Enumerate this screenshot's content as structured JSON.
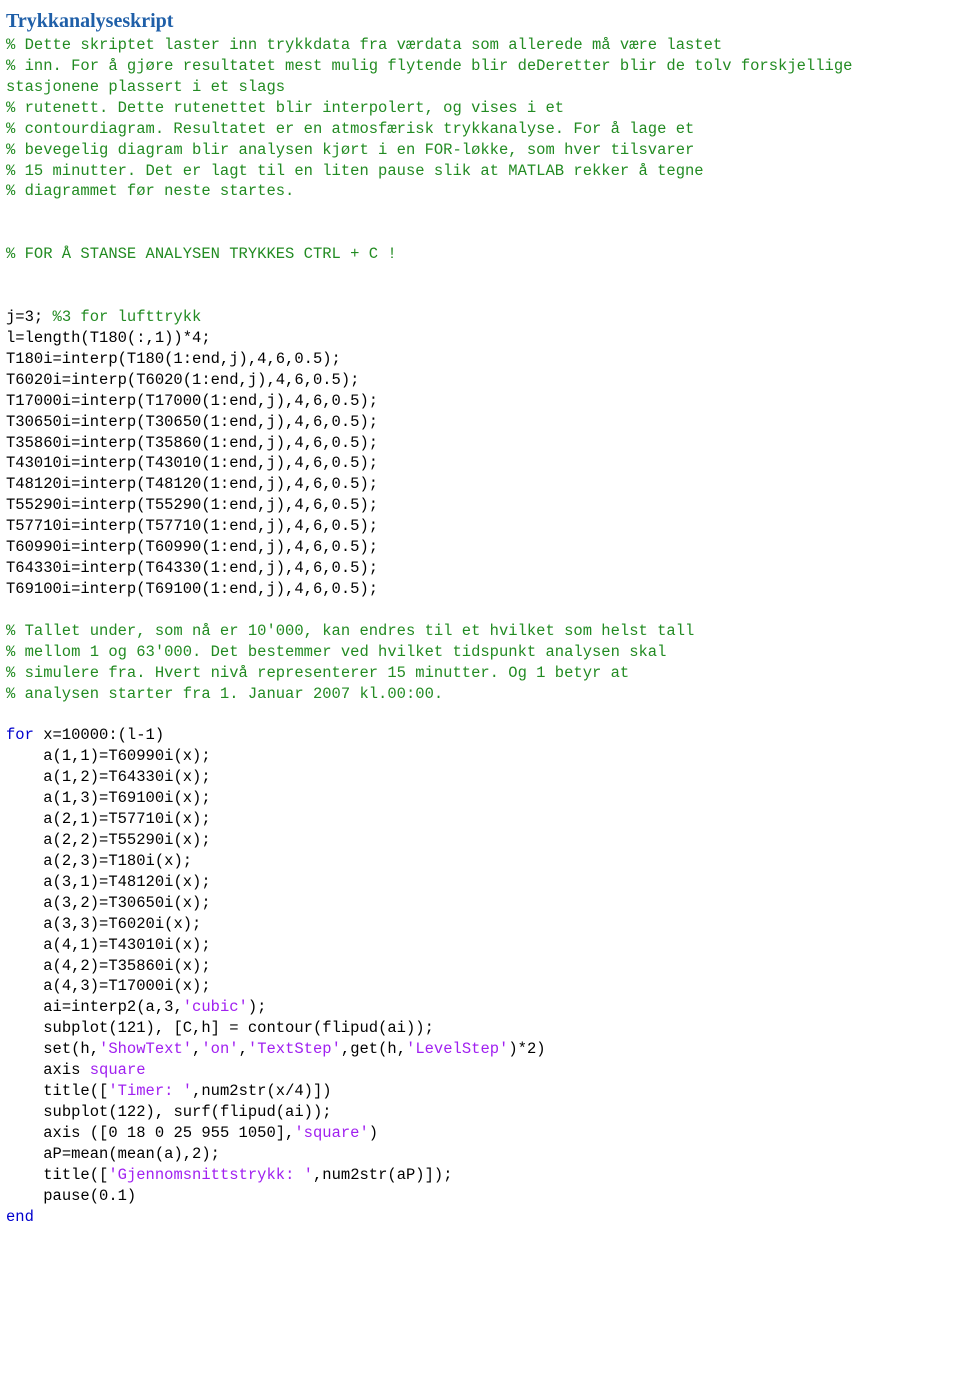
{
  "title": "Trykkanalyseskript",
  "comments": {
    "c1": "% Dette skriptet laster inn trykkdata fra værdata som allerede må være lastet",
    "c2": "% inn. For å gjøre resultatet mest mulig flytende blir deDeretter blir de tolv forskjellige stasjonene plassert i et slags",
    "c3": "% rutenett. Dette rutenettet blir interpolert, og vises i et",
    "c4": "% contourdiagram. Resultatet er en atmosfærisk trykkanalyse. For å lage et",
    "c5": "% bevegelig diagram blir analysen kjørt i en FOR-løkke, som hver tilsvarer",
    "c6": "% 15 minutter. Det er lagt til en liten pause slik at MATLAB rekker å tegne",
    "c7": "% diagrammet før neste startes.",
    "c8": "",
    "stop": "% FOR Å STANSE ANALYSEN TRYKKES CTRL + C !",
    "b1": "% Tallet under, som nå er 10'000, kan endres til et hvilket som helst tall",
    "b2": "% mellom 1 og 63'000. Det bestemmer ved hvilket tidspunkt analysen skal",
    "b3": "% simulere fra. Hvert nivå representerer 15 minutter. Og 1 betyr at",
    "b4": "% analysen starter fra 1. Januar 2007 kl.00:00."
  },
  "code": {
    "j_line": "j=3; ",
    "j_comment": "%3 for lufttrykk",
    "l_line": "l=length(T180(:,1))*4;",
    "interp": [
      "T180i=interp(T180(1:end,j),4,6,0.5);",
      "T6020i=interp(T6020(1:end,j),4,6,0.5);",
      "T17000i=interp(T17000(1:end,j),4,6,0.5);",
      "T30650i=interp(T30650(1:end,j),4,6,0.5);",
      "T35860i=interp(T35860(1:end,j),4,6,0.5);",
      "T43010i=interp(T43010(1:end,j),4,6,0.5);",
      "T48120i=interp(T48120(1:end,j),4,6,0.5);",
      "T55290i=interp(T55290(1:end,j),4,6,0.5);",
      "T57710i=interp(T57710(1:end,j),4,6,0.5);",
      "T60990i=interp(T60990(1:end,j),4,6,0.5);",
      "T64330i=interp(T64330(1:end,j),4,6,0.5);",
      "T69100i=interp(T69100(1:end,j),4,6,0.5);"
    ],
    "for_kw": "for",
    "for_args": " x=10000:(l-1)",
    "body": [
      "    a(1,1)=T60990i(x);",
      "    a(1,2)=T64330i(x);",
      "    a(1,3)=T69100i(x);",
      "    a(2,1)=T57710i(x);",
      "    a(2,2)=T55290i(x);",
      "    a(2,3)=T180i(x);",
      "    a(3,1)=T48120i(x);",
      "    a(3,2)=T30650i(x);",
      "    a(3,3)=T6020i(x);",
      "    a(4,1)=T43010i(x);",
      "    a(4,2)=T35860i(x);",
      "    a(4,3)=T17000i(x);"
    ],
    "interp2_a": "    ai=interp2(a,3,",
    "str_cubic": "'cubic'",
    "interp2_b": ");",
    "subplot1": "    subplot(121), [C,h] = contour(flipud(ai));",
    "set_a": "    set(h,",
    "str_showtext": "'ShowText'",
    "comma1": ",",
    "str_on": "'on'",
    "comma2": ",",
    "str_textstep": "'TextStep'",
    "set_b": ",get(h,",
    "str_levelstep": "'LevelStep'",
    "set_c": ")*2)",
    "axis1": "    axis ",
    "str_square1": "square",
    "title1_a": "    title([",
    "str_timer": "'Timer: '",
    "title1_b": ",num2str(x/4)])",
    "subplot2": "    subplot(122), surf(flipud(ai));",
    "axis2_a": "    axis ([0 18 0 25 955 1050],",
    "str_square2": "'square'",
    "axis2_b": ")",
    "aP": "    aP=mean(mean(a),2);",
    "title2_a": "    title([",
    "str_gjennom": "'Gjennomsnittstrykk: '",
    "title2_b": ",num2str(aP)]);",
    "pause": "    pause(0.1)",
    "end_kw": "end"
  }
}
